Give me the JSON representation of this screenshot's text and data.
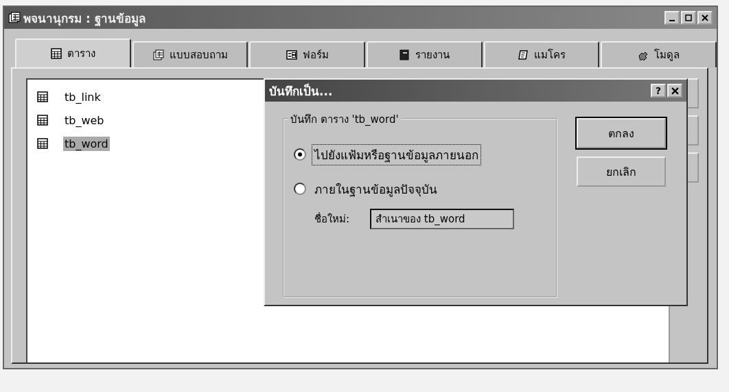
{
  "window": {
    "title": "พจนานุกรม : ฐานข้อมูล"
  },
  "tabs": [
    {
      "label": "ตาราง",
      "kind": "table",
      "selected": true
    },
    {
      "label": "แบบสอบถาม",
      "kind": "query",
      "selected": false
    },
    {
      "label": "ฟอร์ม",
      "kind": "form",
      "selected": false
    },
    {
      "label": "รายงาน",
      "kind": "report",
      "selected": false
    },
    {
      "label": "แมโคร",
      "kind": "macro",
      "selected": false
    },
    {
      "label": "โมดูล",
      "kind": "module",
      "selected": false
    }
  ],
  "objects": [
    {
      "name": "tb_link",
      "selected": false
    },
    {
      "name": "tb_web",
      "selected": false
    },
    {
      "name": "tb_word",
      "selected": true
    }
  ],
  "dialog": {
    "title": "บันทึกเป็น...",
    "help": "?",
    "group_label": "บันทึก ตาราง 'tb_word'",
    "options": [
      {
        "label": "ไปยังแฟ้มหรือฐานข้อมูลภายนอก",
        "selected": true
      },
      {
        "label": "ภายในฐานข้อมูลปัจจุบัน",
        "selected": false
      }
    ],
    "name_label": "ชื่อใหม่:",
    "name_value": "สำเนาของ tb_word",
    "buttons": [
      {
        "label": "ตกลง",
        "default": true
      },
      {
        "label": "ยกเลิก",
        "default": false
      }
    ]
  }
}
